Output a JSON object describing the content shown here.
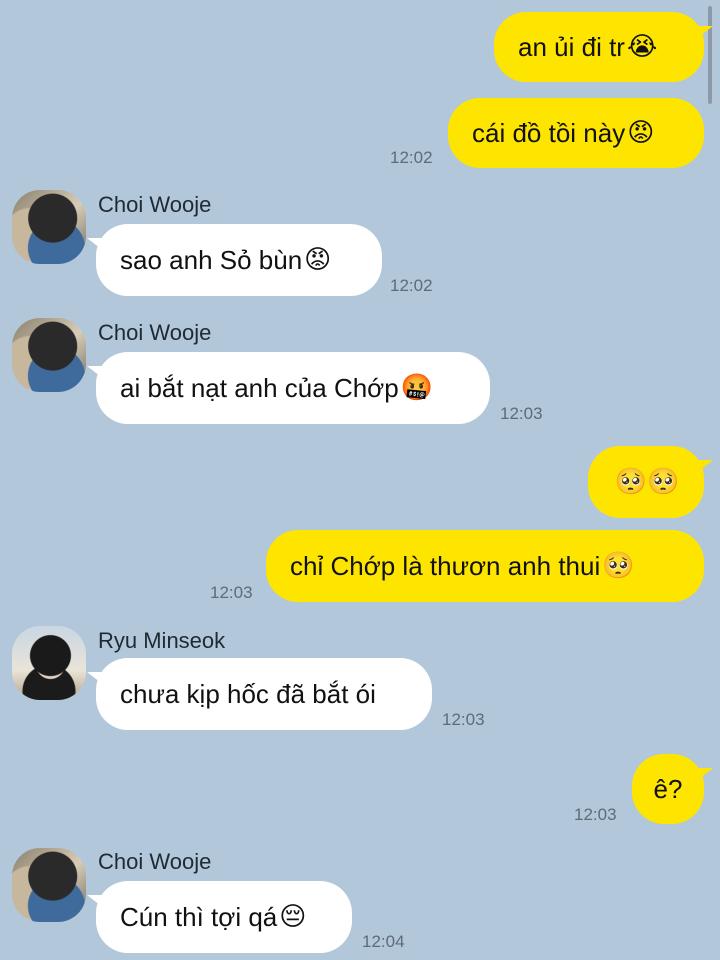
{
  "messages": [
    {
      "sender": "me",
      "text": "an ủi đi tr",
      "emoji": "😭",
      "time": ""
    },
    {
      "sender": "me",
      "text": "cái đồ tồi này",
      "emoji": "😡",
      "time": "12:02"
    },
    {
      "sender": "Choi Wooje",
      "text": "sao anh Sỏ bùn",
      "emoji": "😡",
      "time": "12:02"
    },
    {
      "sender": "Choi Wooje",
      "text": "ai bắt nạt anh của Chớp",
      "emoji": "🤬",
      "time": "12:03"
    },
    {
      "sender": "me",
      "text": "",
      "emoji": "🥺🥺",
      "time": ""
    },
    {
      "sender": "me",
      "text": "chỉ Chớp là thươn anh thui ",
      "emoji": "🥺",
      "time": "12:03"
    },
    {
      "sender": "Ryu Minseok",
      "text": "chưa kịp hốc đã bắt ói",
      "emoji": "",
      "time": "12:03"
    },
    {
      "sender": "me",
      "text": "ê?",
      "emoji": "",
      "time": "12:03"
    },
    {
      "sender": "Choi Wooje",
      "text": "Cún thì tợi qá",
      "emoji": "😔",
      "time": "12:04"
    }
  ],
  "icons": {
    "avatar_choi": "user-avatar-photo",
    "avatar_ryu": "user-avatar-photo"
  },
  "colors": {
    "background": "#b2c7da",
    "my_bubble": "#fee500",
    "their_bubble": "#ffffff"
  }
}
